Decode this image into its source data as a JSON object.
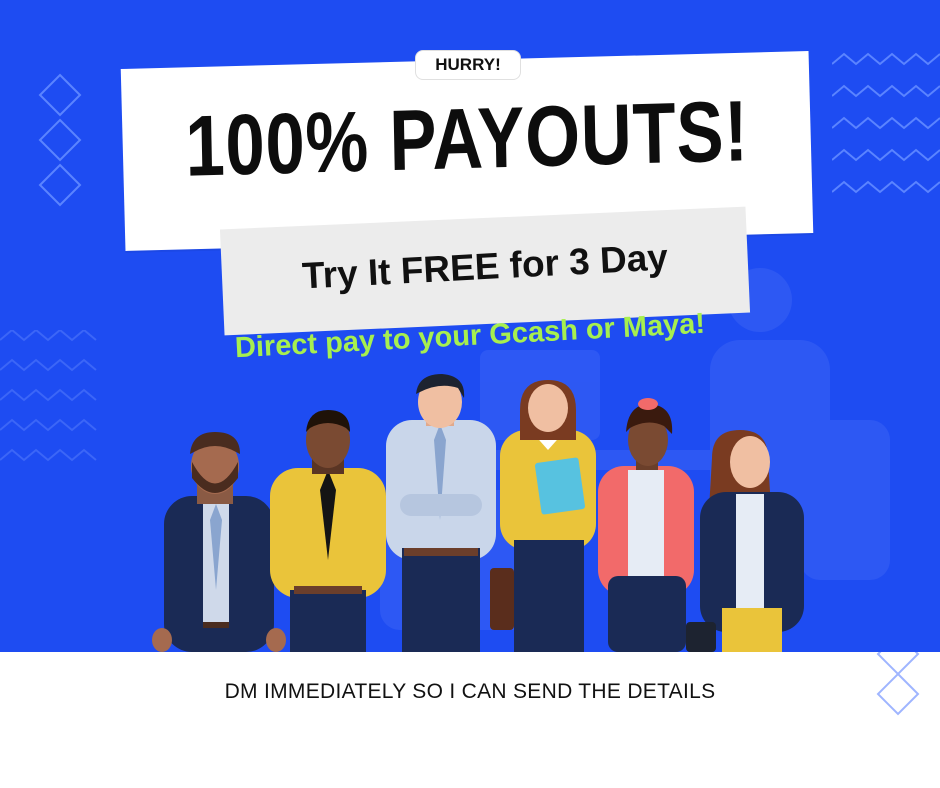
{
  "badge": {
    "label": "HURRY!"
  },
  "headline": {
    "title": "100% PAYOUTS!"
  },
  "offer": {
    "text": "Try It FREE for 3 Day"
  },
  "tagline": {
    "text": "Direct pay to your Gcash or Maya!"
  },
  "footer": {
    "text": "DM IMMEDIATELY SO I CAN SEND THE DETAILS"
  },
  "colors": {
    "background": "#1e4cf2",
    "accent_green": "#a7ef4f",
    "card": "#ffffff",
    "card_secondary": "#ececec"
  },
  "icons": [
    "diamond-pattern-icon",
    "zigzag-pattern-icon"
  ]
}
